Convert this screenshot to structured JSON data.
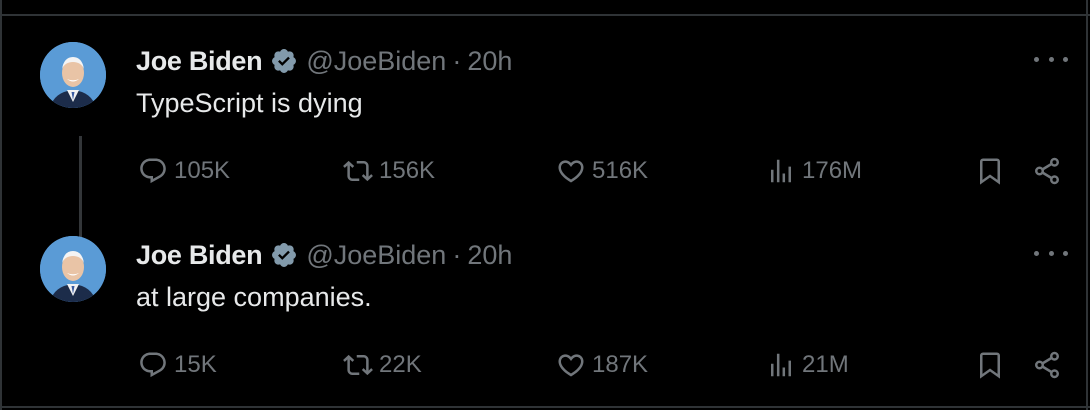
{
  "tweets": [
    {
      "author": {
        "name": "Joe Biden",
        "handle": "@JoeBiden",
        "verified": true
      },
      "separator": "·",
      "time": "20h",
      "text": "TypeScript is dying",
      "stats": {
        "replies": "105K",
        "retweets": "156K",
        "likes": "516K",
        "views": "176M"
      }
    },
    {
      "author": {
        "name": "Joe Biden",
        "handle": "@JoeBiden",
        "verified": true
      },
      "separator": "·",
      "time": "20h",
      "text": "at large companies.",
      "stats": {
        "replies": "15K",
        "retweets": "22K",
        "likes": "187K",
        "views": "21M"
      }
    }
  ],
  "colors": {
    "background": "#000000",
    "primary_text": "#e7e9ea",
    "secondary_text": "#71767b",
    "border": "#2f3336"
  },
  "icons": [
    "verified-badge-icon",
    "more-icon",
    "reply-icon",
    "retweet-icon",
    "like-icon",
    "views-icon",
    "bookmark-icon",
    "share-icon"
  ]
}
